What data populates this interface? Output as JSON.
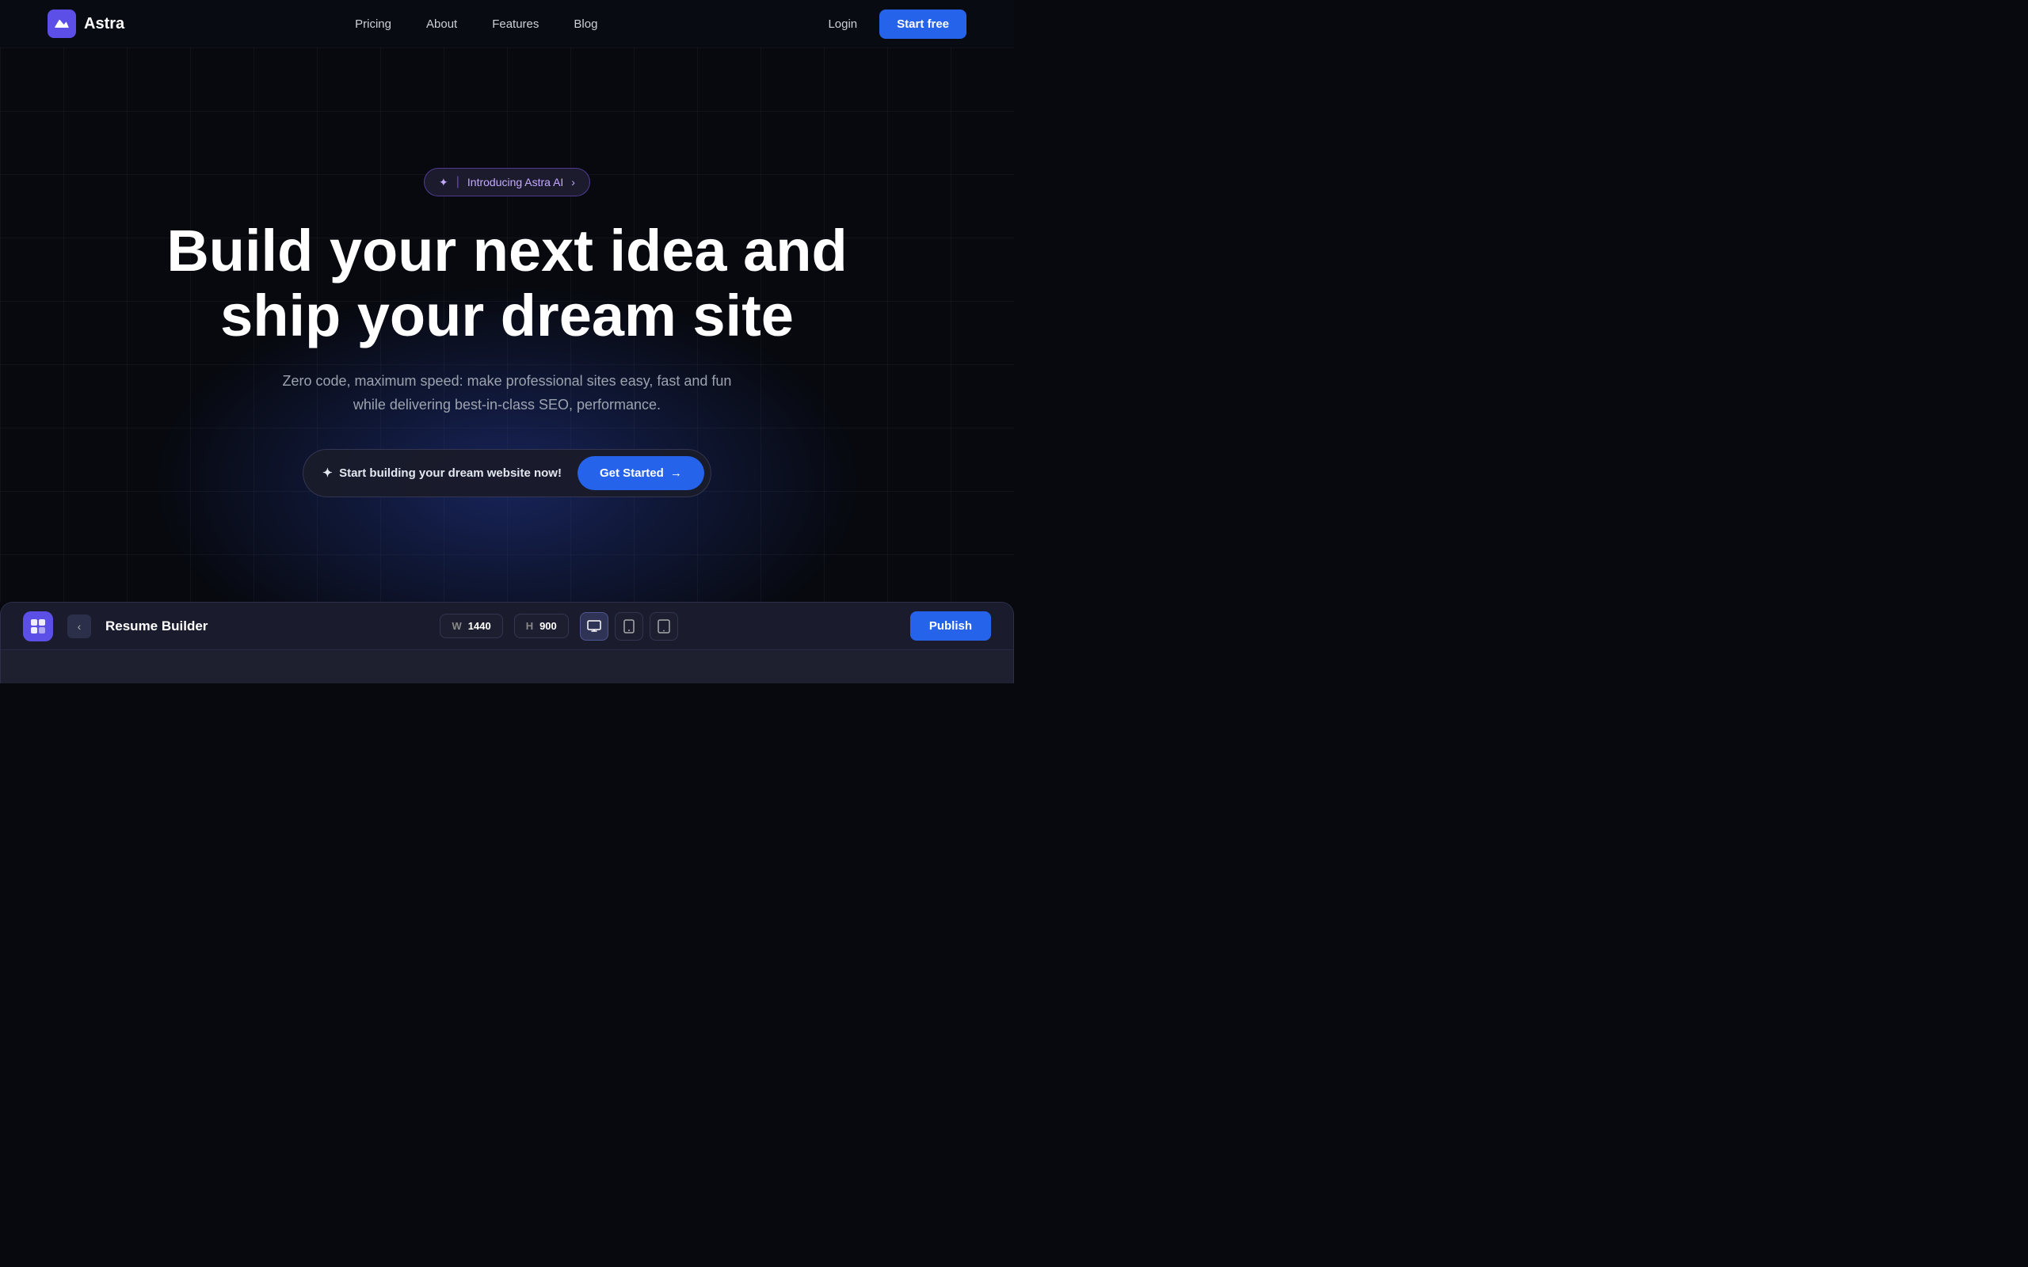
{
  "brand": {
    "name": "Astra",
    "logo_alt": "Astra logo"
  },
  "nav": {
    "links": [
      {
        "label": "Pricing",
        "id": "pricing"
      },
      {
        "label": "About",
        "id": "about"
      },
      {
        "label": "Features",
        "id": "features"
      },
      {
        "label": "Blog",
        "id": "blog"
      }
    ],
    "login_label": "Login",
    "start_free_label": "Start free"
  },
  "hero": {
    "badge_icon": "✦",
    "badge_text": "Introducing Astra AI",
    "badge_arrow": "›",
    "title_line1": "Build your next idea and",
    "title_line2": "ship your dream site",
    "subtitle": "Zero code, maximum speed: make professional sites easy, fast and fun while delivering best-in-class SEO, performance.",
    "cta_icon": "✦",
    "cta_text": "Start building your dream website now!",
    "cta_button": "Get Started",
    "cta_button_arrow": "→"
  },
  "builder": {
    "app_icon": "⊞",
    "back_label": "‹",
    "title": "Resume Builder",
    "width_label": "W",
    "width_value": "1440",
    "height_label": "H",
    "height_value": "900",
    "publish_label": "Publish",
    "devices": [
      {
        "icon": "🖥",
        "label": "desktop",
        "active": true
      },
      {
        "icon": "📱",
        "label": "mobile",
        "active": false
      },
      {
        "icon": "⬛",
        "label": "tablet",
        "active": false
      }
    ]
  }
}
